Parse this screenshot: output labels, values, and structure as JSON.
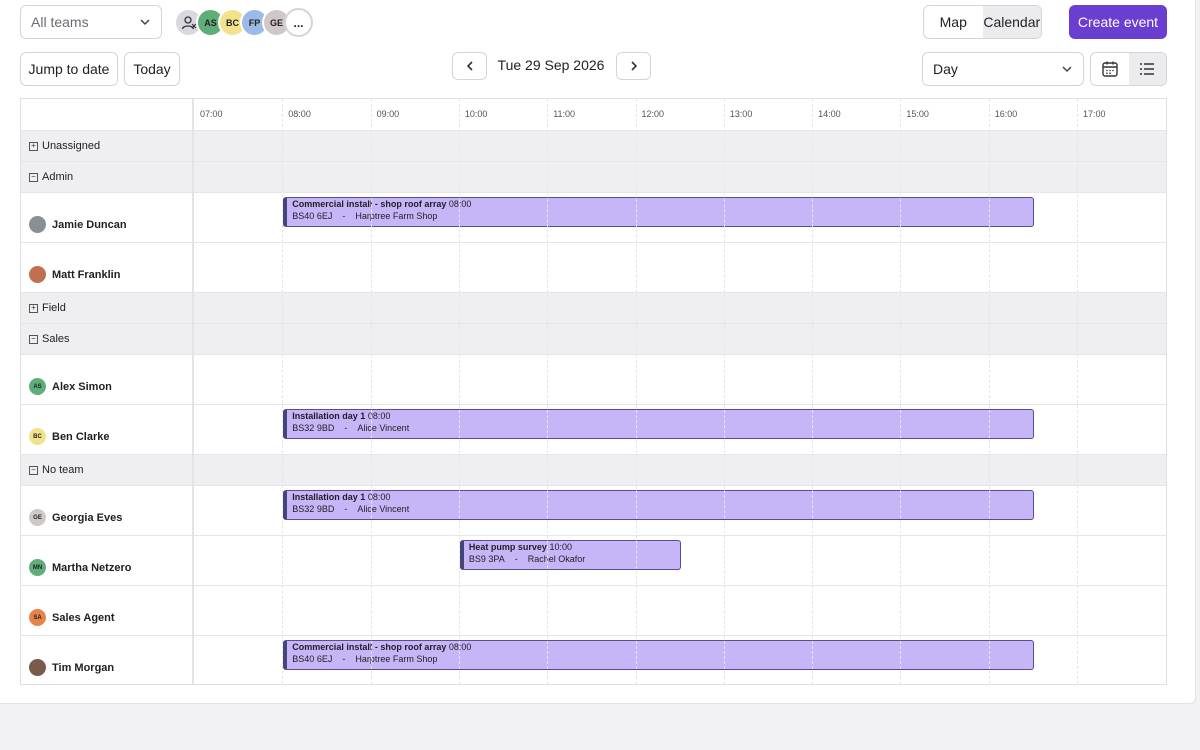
{
  "toolbar": {
    "team_filter": "All teams",
    "avatars": [
      {
        "initials": "",
        "icon": "user-assign-icon",
        "color": "#d8d8de"
      },
      {
        "initials": "AS",
        "color": "#5fae7a"
      },
      {
        "initials": "BC",
        "color": "#f2e28c"
      },
      {
        "initials": "FP",
        "color": "#9db9e8"
      },
      {
        "initials": "GE",
        "color": "#d0c8c8"
      },
      {
        "initials": "...",
        "color": "#ffffff"
      }
    ],
    "view_map": "Map",
    "view_calendar": "Calendar",
    "create_event": "Create event",
    "jump_to_date": "Jump to date",
    "today": "Today",
    "current_date": "Tue 29 Sep 2026",
    "range_select": "Day"
  },
  "calendar": {
    "hours": [
      "07:00",
      "08:00",
      "09:00",
      "10:00",
      "11:00",
      "12:00",
      "13:00",
      "14:00",
      "15:00",
      "16:00",
      "17:00"
    ],
    "rows": [
      {
        "type": "group",
        "label": "Unassigned",
        "expanded": false
      },
      {
        "type": "group",
        "label": "Admin",
        "expanded": true
      },
      {
        "type": "person",
        "label": "Jamie Duncan",
        "avatar": "photo",
        "color": "#8a8f96",
        "initials": ""
      },
      {
        "type": "person",
        "label": "Matt Franklin",
        "avatar": "photo",
        "color": "#c0704f",
        "initials": ""
      },
      {
        "type": "group",
        "label": "Field",
        "expanded": false
      },
      {
        "type": "group",
        "label": "Sales",
        "expanded": true
      },
      {
        "type": "person",
        "label": "Alex Simon",
        "avatar": "initials",
        "color": "#5fae7a",
        "initials": "AS"
      },
      {
        "type": "person",
        "label": "Ben Clarke",
        "avatar": "initials",
        "color": "#f2e28c",
        "initials": "BC"
      },
      {
        "type": "group",
        "label": "No team",
        "expanded": true
      },
      {
        "type": "person",
        "label": "Georgia Eves",
        "avatar": "initials",
        "color": "#d0c8c8",
        "initials": "GE"
      },
      {
        "type": "person",
        "label": "Martha Netzero",
        "avatar": "initials",
        "color": "#5fae7a",
        "initials": "MN"
      },
      {
        "type": "person",
        "label": "Sales Agent",
        "avatar": "initials",
        "color": "#e8844a",
        "initials": "SA"
      },
      {
        "type": "person",
        "label": "Tim Morgan",
        "avatar": "photo",
        "color": "#7a5a48",
        "initials": ""
      }
    ],
    "events": [
      {
        "row": 2,
        "title": "Commercial install - shop roof array",
        "time": "08:00",
        "postcode": "BS40 6EJ",
        "sep": "-",
        "contact": "Harptree Farm Shop",
        "start": "08:00",
        "end": "16:30"
      },
      {
        "row": 7,
        "title": "Installation day 1",
        "time": "08:00",
        "postcode": "BS32 9BD",
        "sep": "-",
        "contact": "Alice Vincent",
        "start": "08:00",
        "end": "16:30"
      },
      {
        "row": 9,
        "title": "Installation day 1",
        "time": "08:00",
        "postcode": "BS32 9BD",
        "sep": "-",
        "contact": "Alice Vincent",
        "start": "08:00",
        "end": "16:30"
      },
      {
        "row": 10,
        "title": "Heat pump survey",
        "time": "10:00",
        "postcode": "BS9 3PA",
        "sep": "-",
        "contact": "Rachel Okafor",
        "start": "10:00",
        "end": "12:30"
      },
      {
        "row": 12,
        "title": "Commercial install - shop roof array",
        "time": "08:00",
        "postcode": "BS40 6EJ",
        "sep": "-",
        "contact": "Harptree Farm Shop",
        "start": "08:00",
        "end": "16:30"
      }
    ]
  }
}
